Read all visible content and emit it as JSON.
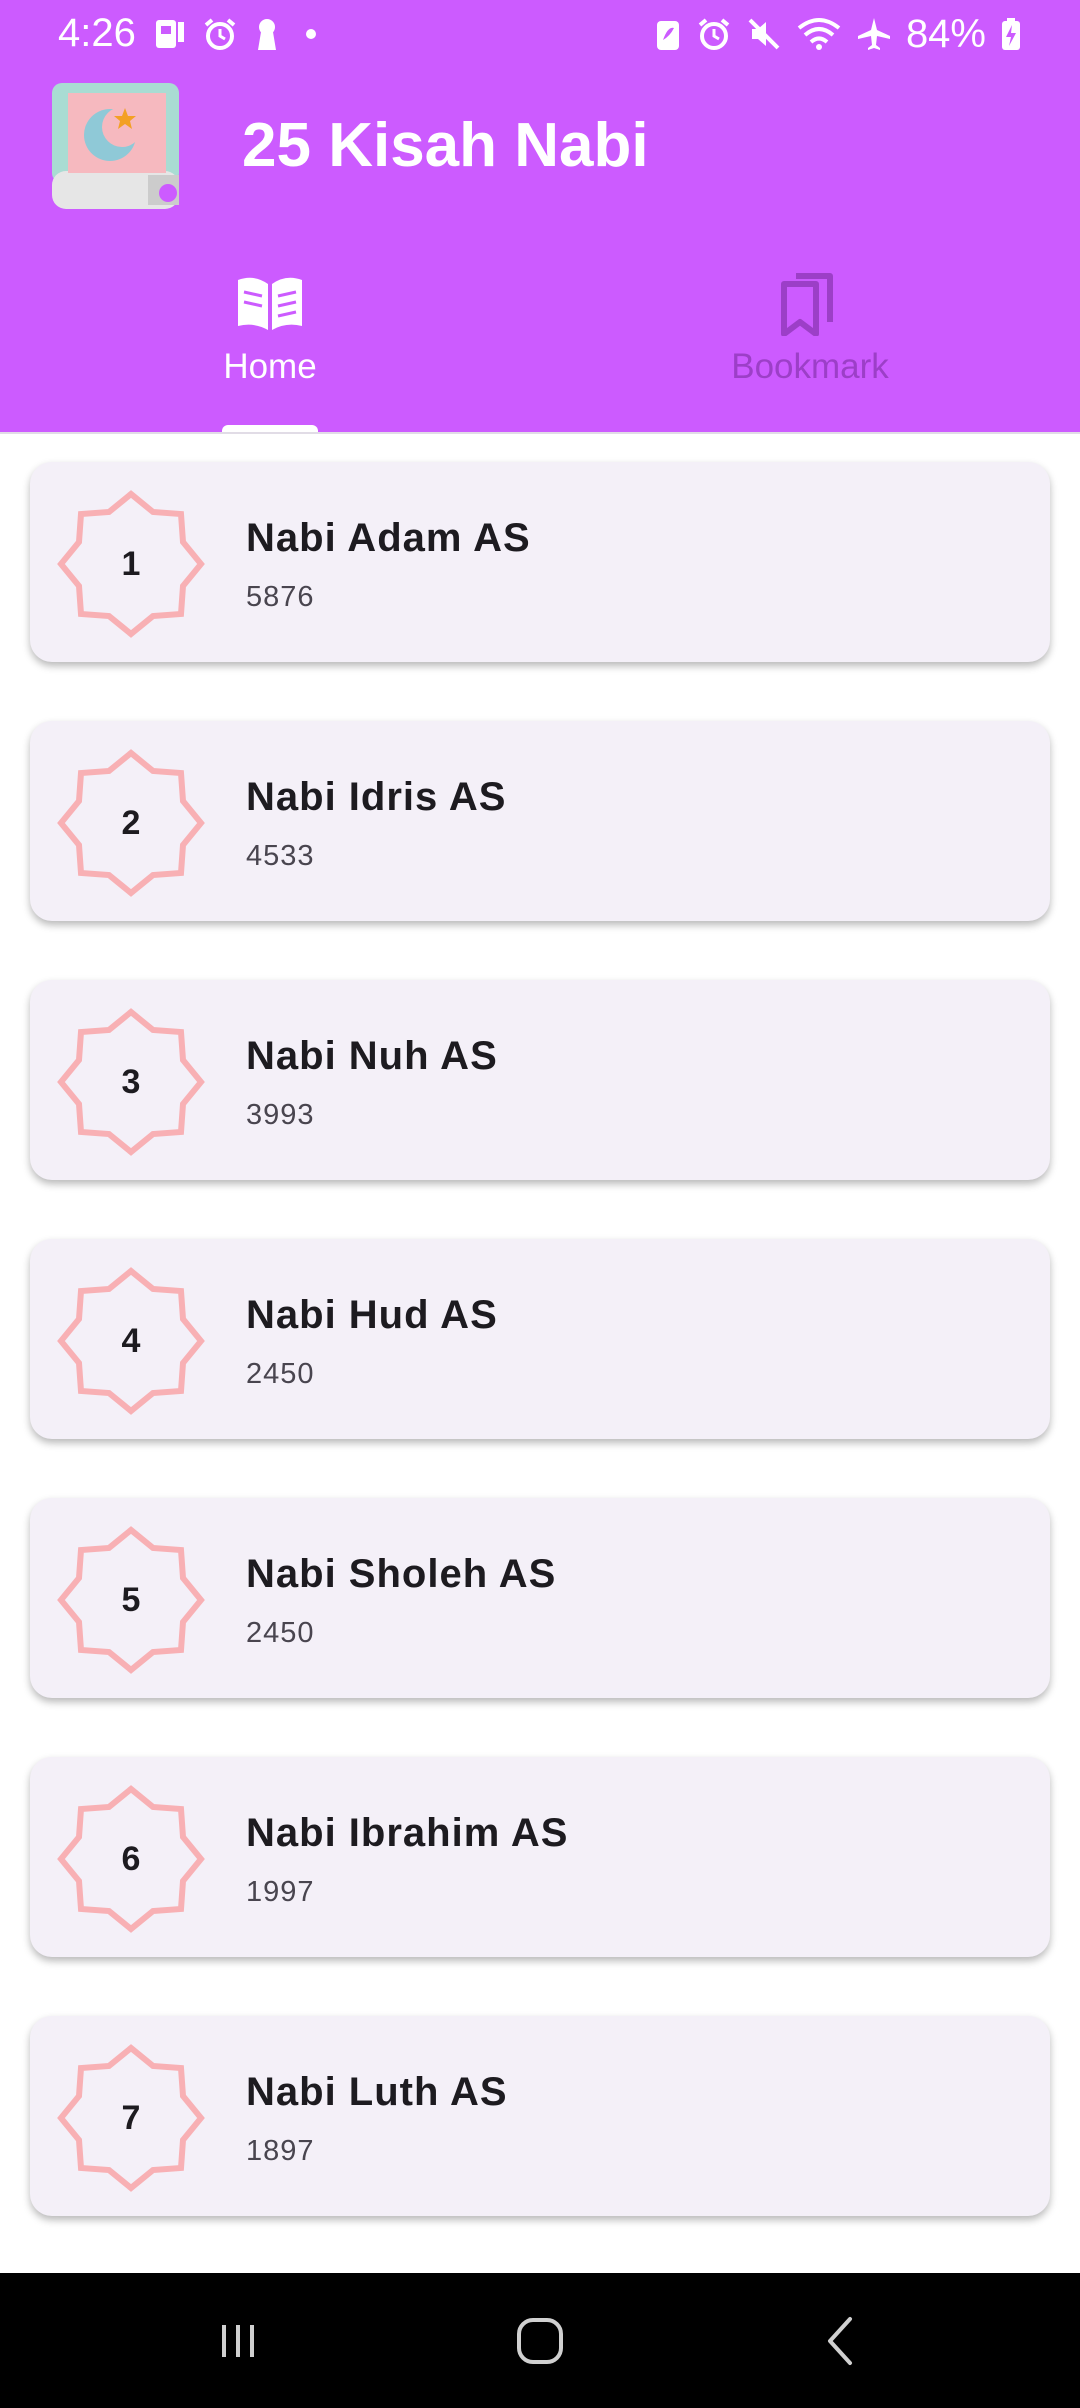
{
  "status_bar": {
    "time": "4:26",
    "battery": "84%",
    "left_icons": [
      "sim-icon",
      "alarm-icon",
      "keyhole-icon",
      "dot-icon"
    ],
    "right_icons": [
      "battery-saver-icon",
      "alarm-icon",
      "mute-icon",
      "wifi-icon",
      "airplane-icon",
      "battery-charging-icon"
    ]
  },
  "app": {
    "title": "25 Kisah Nabi",
    "logo_icon": "book-crescent-logo-icon"
  },
  "tabs": [
    {
      "label": "Home",
      "icon": "open-book-icon",
      "selected": true
    },
    {
      "label": "Bookmark",
      "icon": "bookmarks-icon",
      "selected": false
    }
  ],
  "colors": {
    "header": "#cc5bff",
    "card_bg": "#f4f0f8",
    "star_outline": "#f8b0b4",
    "tab_inactive": "#9c3fc7"
  },
  "stories": [
    {
      "number": "1",
      "title": "Nabi Adam AS",
      "count": "5876"
    },
    {
      "number": "2",
      "title": "Nabi Idris AS",
      "count": "4533"
    },
    {
      "number": "3",
      "title": "Nabi Nuh AS",
      "count": "3993"
    },
    {
      "number": "4",
      "title": "Nabi Hud AS",
      "count": "2450"
    },
    {
      "number": "5",
      "title": "Nabi Sholeh AS",
      "count": "2450"
    },
    {
      "number": "6",
      "title": "Nabi Ibrahim AS",
      "count": "1997"
    },
    {
      "number": "7",
      "title": "Nabi Luth AS",
      "count": "1897"
    }
  ],
  "nav_bar": {
    "buttons": [
      "recents-icon",
      "home-icon",
      "back-icon"
    ]
  }
}
